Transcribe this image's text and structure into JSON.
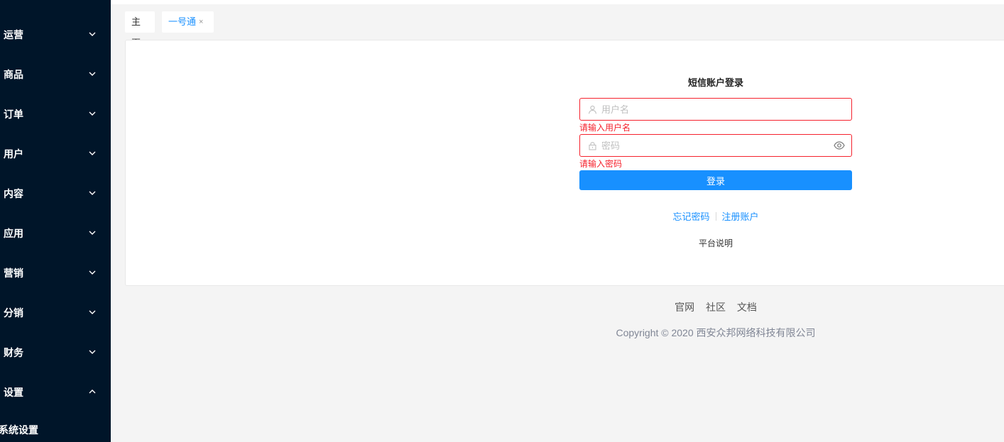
{
  "sidebar": {
    "items": [
      {
        "label": "运营",
        "expanded": false
      },
      {
        "label": "商品",
        "expanded": false
      },
      {
        "label": "订单",
        "expanded": false
      },
      {
        "label": "用户",
        "expanded": false
      },
      {
        "label": "内容",
        "expanded": false
      },
      {
        "label": "应用",
        "expanded": false
      },
      {
        "label": "营销",
        "expanded": false
      },
      {
        "label": "分销",
        "expanded": false
      },
      {
        "label": "财务",
        "expanded": false
      },
      {
        "label": "设置",
        "expanded": true
      }
    ],
    "sub_item": "系统设置"
  },
  "tabs": [
    {
      "label": "主页"
    },
    {
      "label": "一号通",
      "close": "×"
    }
  ],
  "login": {
    "title": "短信账户登录",
    "username_placeholder": "用户名",
    "username_error": "请输入用户名",
    "password_placeholder": "密码",
    "password_error": "请输入密码",
    "submit_label": "登录",
    "forgot_label": "忘记密码",
    "register_label": "注册账户",
    "platform_label": "平台说明"
  },
  "footer": {
    "links": [
      "官网",
      "社区",
      "文档"
    ],
    "copyright": "Copyright © 2020 西安众邦网络科技有限公司"
  },
  "colors": {
    "sidebar_bg": "#001529",
    "accent": "#1890ff",
    "error": "#f5222d"
  }
}
